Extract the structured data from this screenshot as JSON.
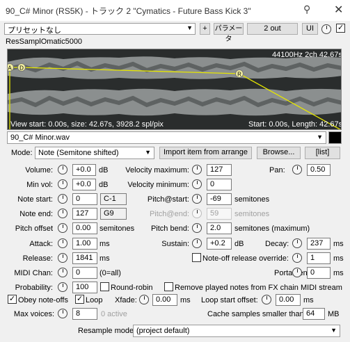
{
  "window": {
    "title": "90_C# Minor (RS5K) - トラック 2 \"Cymatics - Future Bass Kick 3\"",
    "pin_icon": "pin-icon",
    "close_icon": "close-icon"
  },
  "toolbar": {
    "preset": "プリセットなし",
    "plus_label": "+",
    "params_label": "パラメータ",
    "io_label": "2 out",
    "ui_label": "UI",
    "enabled": true
  },
  "plugin_name": "ResSamplOmatic5000",
  "waveform": {
    "format": "44100Hz 2ch 42.67s",
    "view_info": "View start: 0.00s, size: 42.67s, 3928.2 spl/pix",
    "range_info": "Start: 0.00s, Length: 42.67s",
    "markers": [
      "A",
      "D",
      "R"
    ],
    "envelope_color": "#e6e600",
    "background": "#2a2d2d"
  },
  "file": {
    "name": "90_C# Minor.wav"
  },
  "mode": {
    "label": "Mode:",
    "value": "Note (Semitone shifted)",
    "import_btn": "Import item from arrange",
    "browse_btn": "Browse...",
    "list_btn": "[list]"
  },
  "params": {
    "volume": {
      "label": "Volume:",
      "value": "+0.0",
      "unit": "dB"
    },
    "min_vol": {
      "label": "Min vol:",
      "value": "+0.0",
      "unit": "dB"
    },
    "note_start": {
      "label": "Note start:",
      "value": "0",
      "note": "C-1"
    },
    "note_end": {
      "label": "Note end:",
      "value": "127",
      "note": "G9"
    },
    "pitch_offset": {
      "label": "Pitch offset",
      "value": "0.00",
      "unit": "semitones"
    },
    "attack": {
      "label": "Attack:",
      "value": "1.00",
      "unit": "ms"
    },
    "release": {
      "label": "Release:",
      "value": "1841",
      "unit": "ms"
    },
    "midi_chan": {
      "label": "MIDI Chan:",
      "value": "0",
      "unit": "(0=all)"
    },
    "probability": {
      "label": "Probability:",
      "value": "100",
      "round_robin": "Round-robin"
    },
    "vel_max": {
      "label": "Velocity maximum:",
      "value": "127"
    },
    "vel_min": {
      "label": "Velocity minimum:",
      "value": "0"
    },
    "pitch_start": {
      "label": "Pitch@start:",
      "value": "-69",
      "unit": "semitones"
    },
    "pitch_end": {
      "label": "Pitch@end:",
      "value": "59",
      "unit": "semitones"
    },
    "pitch_bend": {
      "label": "Pitch bend:",
      "value": "2.0",
      "unit": "semitones (maximum)"
    },
    "sustain": {
      "label": "Sustain:",
      "value": "+0.2",
      "unit": "dB"
    },
    "pan": {
      "label": "Pan:",
      "value": "0.50"
    },
    "decay": {
      "label": "Decay:",
      "value": "237",
      "unit": "ms"
    },
    "noteoff_override": {
      "label": "Note-off release override:",
      "value": "1",
      "unit": "ms"
    },
    "portamento": {
      "label": "Portamento:",
      "value": "0",
      "unit": "ms"
    },
    "remove_notes": {
      "label": "Remove played notes from FX chain MIDI stream"
    }
  },
  "bottom": {
    "obey_noteoffs": "Obey note-offs",
    "loop": "Loop",
    "xfade_label": "Xfade:",
    "xfade_value": "0.00",
    "xfade_unit": "ms",
    "loop_offset_label": "Loop start offset:",
    "loop_offset_value": "0.00",
    "loop_offset_unit": "ms",
    "max_voices_label": "Max voices:",
    "max_voices_value": "8",
    "max_voices_active": "0 active",
    "cache_label": "Cache samples smaller than:",
    "cache_value": "64",
    "cache_unit": "MB",
    "resample_label": "Resample mode:",
    "resample_value": "(project default)"
  }
}
